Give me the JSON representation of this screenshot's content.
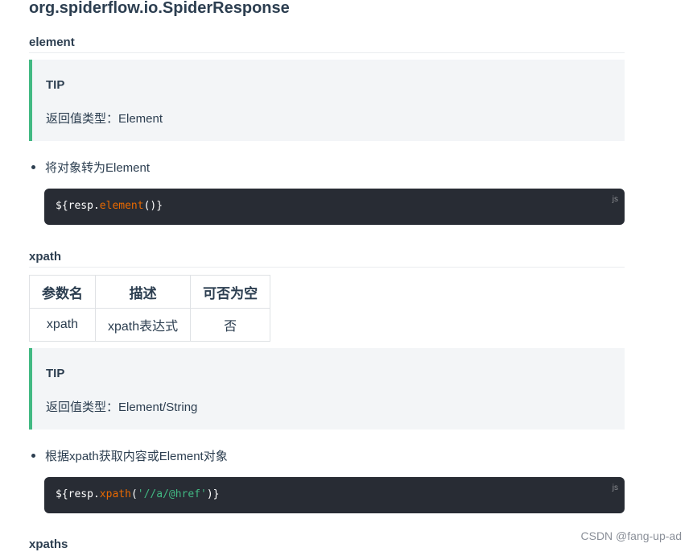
{
  "page": {
    "title": "org.spiderflow.io.SpiderResponse"
  },
  "sections": [
    {
      "heading": "element",
      "tip_title": "TIP",
      "tip_text": "返回值类型：Element",
      "bullet": "将对象转为Element",
      "code": {
        "prefix": "${resp.",
        "fn": "element",
        "open": "(",
        "arg": "",
        "close": ")}",
        "lang": "js"
      }
    },
    {
      "heading": "xpath",
      "table": {
        "headers": [
          "参数名",
          "描述",
          "可否为空"
        ],
        "rows": [
          [
            "xpath",
            "xpath表达式",
            "否"
          ]
        ]
      },
      "tip_title": "TIP",
      "tip_text": "返回值类型：Element/String",
      "bullet": "根据xpath获取内容或Element对象",
      "code": {
        "prefix": "${resp.",
        "fn": "xpath",
        "open": "(",
        "arg": "'//a/@href'",
        "close": ")}",
        "lang": "js"
      }
    },
    {
      "heading": "xpaths"
    }
  ],
  "watermark": "CSDN @fang-up-ad"
}
